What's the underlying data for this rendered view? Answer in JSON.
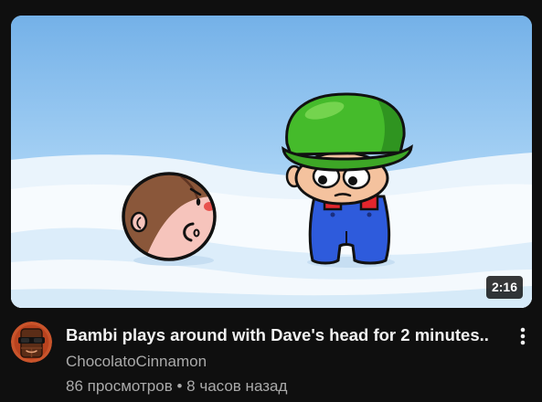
{
  "theme": {
    "background": "#0f0f0f",
    "title_color": "#f1f1f1",
    "secondary_color": "#aaaaaa"
  },
  "icons": {
    "menu": "more-vert-icon"
  },
  "video": {
    "duration": "2:16",
    "title": "Bambi plays around with Dave's head for 2 minutes..",
    "channel": "ChocolatoCinnamon",
    "views": "86 просмотров",
    "separator": "•",
    "age": "8 часов назад"
  }
}
